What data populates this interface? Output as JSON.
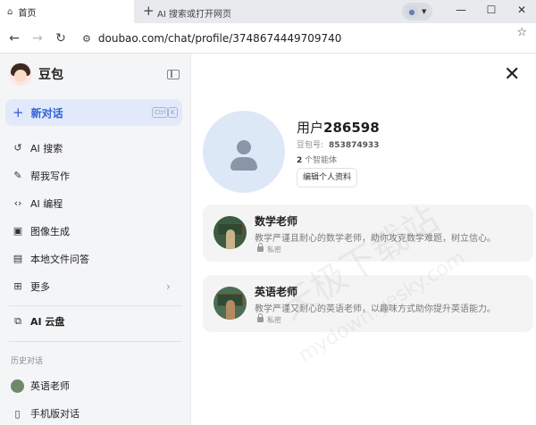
{
  "browser": {
    "tabs": [
      {
        "label": "首页",
        "icon": "home-icon"
      },
      {
        "label": "AI 搜索或打开网页",
        "icon": "plus-icon"
      }
    ],
    "url": "doubao.com/chat/profile/3748674449709740"
  },
  "sidebar": {
    "brand": "豆包",
    "new_chat": {
      "label": "新对话",
      "shortcut": [
        "Ctrl",
        "K"
      ]
    },
    "menu": [
      {
        "label": "AI 搜索",
        "icon": "ai-search-icon"
      },
      {
        "label": "帮我写作",
        "icon": "pen-icon"
      },
      {
        "label": "AI 编程",
        "icon": "code-icon"
      },
      {
        "label": "图像生成",
        "icon": "image-icon"
      },
      {
        "label": "本地文件问答",
        "icon": "file-icon"
      },
      {
        "label": "更多",
        "icon": "grid-icon"
      }
    ],
    "cloud": {
      "label": "AI 云盘",
      "icon": "cloud-drive-icon"
    },
    "history_title": "历史对话",
    "history": [
      {
        "label": "英语老师"
      },
      {
        "label": "手机版对话"
      }
    ]
  },
  "profile": {
    "username_prefix": "用户",
    "username_number": "286598",
    "id_label": "豆包号:",
    "id_value": "853874933",
    "agent_count_number": "2",
    "agent_count_suffix": "个智能体",
    "edit_button": "编辑个人资料"
  },
  "agents": [
    {
      "name": "数学老师",
      "description": "教学严谨且耐心的数学老师，助你攻克数学难题，树立信心。",
      "privacy": "私密"
    },
    {
      "name": "英语老师",
      "description": "教学严谨又耐心的英语老师，以趣味方式助你提升英语能力。",
      "privacy": "私密"
    }
  ],
  "watermark": {
    "line1": "天极下载站",
    "line2": "mydown.yesky.com"
  },
  "colors": {
    "accent": "#2b5fd9",
    "new_chat_bg": "#e1e9fb",
    "sidebar_bg": "#f4f5f7",
    "card_bg": "#f4f4f5"
  }
}
